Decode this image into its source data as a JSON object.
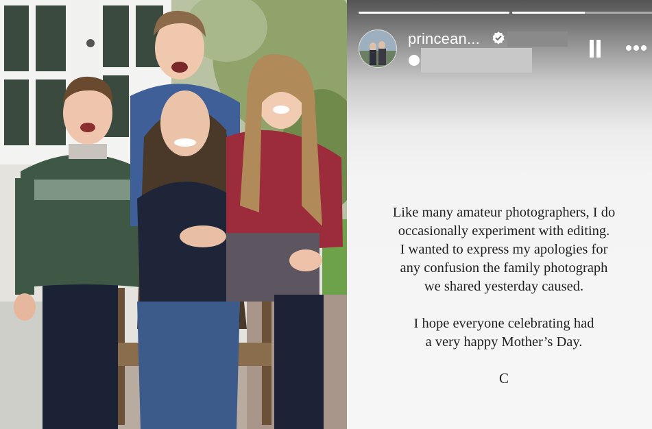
{
  "photo": {
    "subjects": [
      "boy-left",
      "boy-top",
      "woman-center",
      "girl-right"
    ]
  },
  "story": {
    "username": "princean...",
    "progress_segments": [
      1.0,
      0.48
    ],
    "message_lines": [
      "Like many amateur photographers, I do",
      "occasionally experiment with editing.",
      "I wanted to express my apologies for",
      "any confusion the family photograph",
      "we shared yesterday caused.",
      "I hope everyone celebrating had",
      "a very happy Mother’s Day."
    ],
    "signature": "C",
    "icons": [
      "verified-badge-icon",
      "pause-icon",
      "more-options-icon"
    ],
    "colors": {
      "text": "#1f1f1f",
      "header_gradient_top": "#545454",
      "background": "#f6f6f6",
      "verified": "#ffffff"
    }
  }
}
